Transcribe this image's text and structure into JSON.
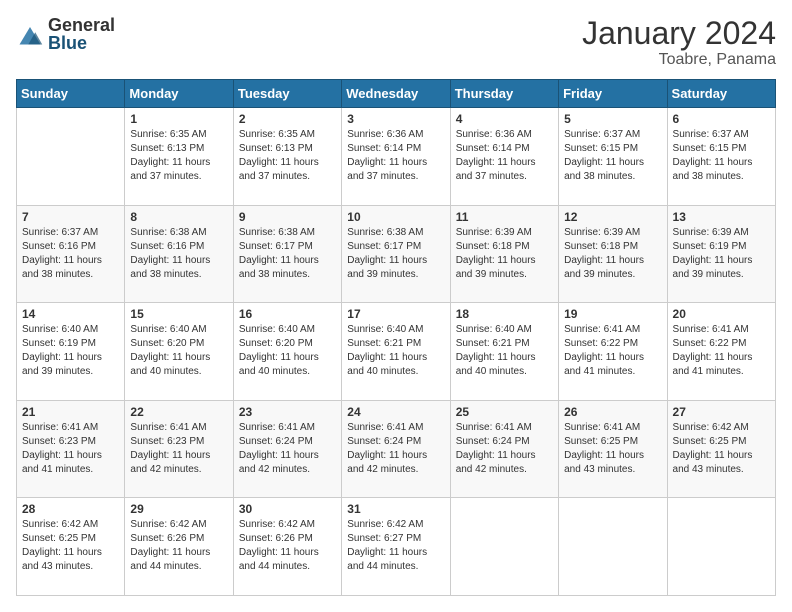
{
  "header": {
    "logo_general": "General",
    "logo_blue": "Blue",
    "title": "January 2024",
    "subtitle": "Toabre, Panama"
  },
  "weekdays": [
    "Sunday",
    "Monday",
    "Tuesday",
    "Wednesday",
    "Thursday",
    "Friday",
    "Saturday"
  ],
  "rows": [
    [
      {
        "day": "",
        "lines": []
      },
      {
        "day": "1",
        "lines": [
          "Sunrise: 6:35 AM",
          "Sunset: 6:13 PM",
          "Daylight: 11 hours",
          "and 37 minutes."
        ]
      },
      {
        "day": "2",
        "lines": [
          "Sunrise: 6:35 AM",
          "Sunset: 6:13 PM",
          "Daylight: 11 hours",
          "and 37 minutes."
        ]
      },
      {
        "day": "3",
        "lines": [
          "Sunrise: 6:36 AM",
          "Sunset: 6:14 PM",
          "Daylight: 11 hours",
          "and 37 minutes."
        ]
      },
      {
        "day": "4",
        "lines": [
          "Sunrise: 6:36 AM",
          "Sunset: 6:14 PM",
          "Daylight: 11 hours",
          "and 37 minutes."
        ]
      },
      {
        "day": "5",
        "lines": [
          "Sunrise: 6:37 AM",
          "Sunset: 6:15 PM",
          "Daylight: 11 hours",
          "and 38 minutes."
        ]
      },
      {
        "day": "6",
        "lines": [
          "Sunrise: 6:37 AM",
          "Sunset: 6:15 PM",
          "Daylight: 11 hours",
          "and 38 minutes."
        ]
      }
    ],
    [
      {
        "day": "7",
        "lines": [
          "Sunrise: 6:37 AM",
          "Sunset: 6:16 PM",
          "Daylight: 11 hours",
          "and 38 minutes."
        ]
      },
      {
        "day": "8",
        "lines": [
          "Sunrise: 6:38 AM",
          "Sunset: 6:16 PM",
          "Daylight: 11 hours",
          "and 38 minutes."
        ]
      },
      {
        "day": "9",
        "lines": [
          "Sunrise: 6:38 AM",
          "Sunset: 6:17 PM",
          "Daylight: 11 hours",
          "and 38 minutes."
        ]
      },
      {
        "day": "10",
        "lines": [
          "Sunrise: 6:38 AM",
          "Sunset: 6:17 PM",
          "Daylight: 11 hours",
          "and 39 minutes."
        ]
      },
      {
        "day": "11",
        "lines": [
          "Sunrise: 6:39 AM",
          "Sunset: 6:18 PM",
          "Daylight: 11 hours",
          "and 39 minutes."
        ]
      },
      {
        "day": "12",
        "lines": [
          "Sunrise: 6:39 AM",
          "Sunset: 6:18 PM",
          "Daylight: 11 hours",
          "and 39 minutes."
        ]
      },
      {
        "day": "13",
        "lines": [
          "Sunrise: 6:39 AM",
          "Sunset: 6:19 PM",
          "Daylight: 11 hours",
          "and 39 minutes."
        ]
      }
    ],
    [
      {
        "day": "14",
        "lines": [
          "Sunrise: 6:40 AM",
          "Sunset: 6:19 PM",
          "Daylight: 11 hours",
          "and 39 minutes."
        ]
      },
      {
        "day": "15",
        "lines": [
          "Sunrise: 6:40 AM",
          "Sunset: 6:20 PM",
          "Daylight: 11 hours",
          "and 40 minutes."
        ]
      },
      {
        "day": "16",
        "lines": [
          "Sunrise: 6:40 AM",
          "Sunset: 6:20 PM",
          "Daylight: 11 hours",
          "and 40 minutes."
        ]
      },
      {
        "day": "17",
        "lines": [
          "Sunrise: 6:40 AM",
          "Sunset: 6:21 PM",
          "Daylight: 11 hours",
          "and 40 minutes."
        ]
      },
      {
        "day": "18",
        "lines": [
          "Sunrise: 6:40 AM",
          "Sunset: 6:21 PM",
          "Daylight: 11 hours",
          "and 40 minutes."
        ]
      },
      {
        "day": "19",
        "lines": [
          "Sunrise: 6:41 AM",
          "Sunset: 6:22 PM",
          "Daylight: 11 hours",
          "and 41 minutes."
        ]
      },
      {
        "day": "20",
        "lines": [
          "Sunrise: 6:41 AM",
          "Sunset: 6:22 PM",
          "Daylight: 11 hours",
          "and 41 minutes."
        ]
      }
    ],
    [
      {
        "day": "21",
        "lines": [
          "Sunrise: 6:41 AM",
          "Sunset: 6:23 PM",
          "Daylight: 11 hours",
          "and 41 minutes."
        ]
      },
      {
        "day": "22",
        "lines": [
          "Sunrise: 6:41 AM",
          "Sunset: 6:23 PM",
          "Daylight: 11 hours",
          "and 42 minutes."
        ]
      },
      {
        "day": "23",
        "lines": [
          "Sunrise: 6:41 AM",
          "Sunset: 6:24 PM",
          "Daylight: 11 hours",
          "and 42 minutes."
        ]
      },
      {
        "day": "24",
        "lines": [
          "Sunrise: 6:41 AM",
          "Sunset: 6:24 PM",
          "Daylight: 11 hours",
          "and 42 minutes."
        ]
      },
      {
        "day": "25",
        "lines": [
          "Sunrise: 6:41 AM",
          "Sunset: 6:24 PM",
          "Daylight: 11 hours",
          "and 42 minutes."
        ]
      },
      {
        "day": "26",
        "lines": [
          "Sunrise: 6:41 AM",
          "Sunset: 6:25 PM",
          "Daylight: 11 hours",
          "and 43 minutes."
        ]
      },
      {
        "day": "27",
        "lines": [
          "Sunrise: 6:42 AM",
          "Sunset: 6:25 PM",
          "Daylight: 11 hours",
          "and 43 minutes."
        ]
      }
    ],
    [
      {
        "day": "28",
        "lines": [
          "Sunrise: 6:42 AM",
          "Sunset: 6:25 PM",
          "Daylight: 11 hours",
          "and 43 minutes."
        ]
      },
      {
        "day": "29",
        "lines": [
          "Sunrise: 6:42 AM",
          "Sunset: 6:26 PM",
          "Daylight: 11 hours",
          "and 44 minutes."
        ]
      },
      {
        "day": "30",
        "lines": [
          "Sunrise: 6:42 AM",
          "Sunset: 6:26 PM",
          "Daylight: 11 hours",
          "and 44 minutes."
        ]
      },
      {
        "day": "31",
        "lines": [
          "Sunrise: 6:42 AM",
          "Sunset: 6:27 PM",
          "Daylight: 11 hours",
          "and 44 minutes."
        ]
      },
      {
        "day": "",
        "lines": []
      },
      {
        "day": "",
        "lines": []
      },
      {
        "day": "",
        "lines": []
      }
    ]
  ]
}
